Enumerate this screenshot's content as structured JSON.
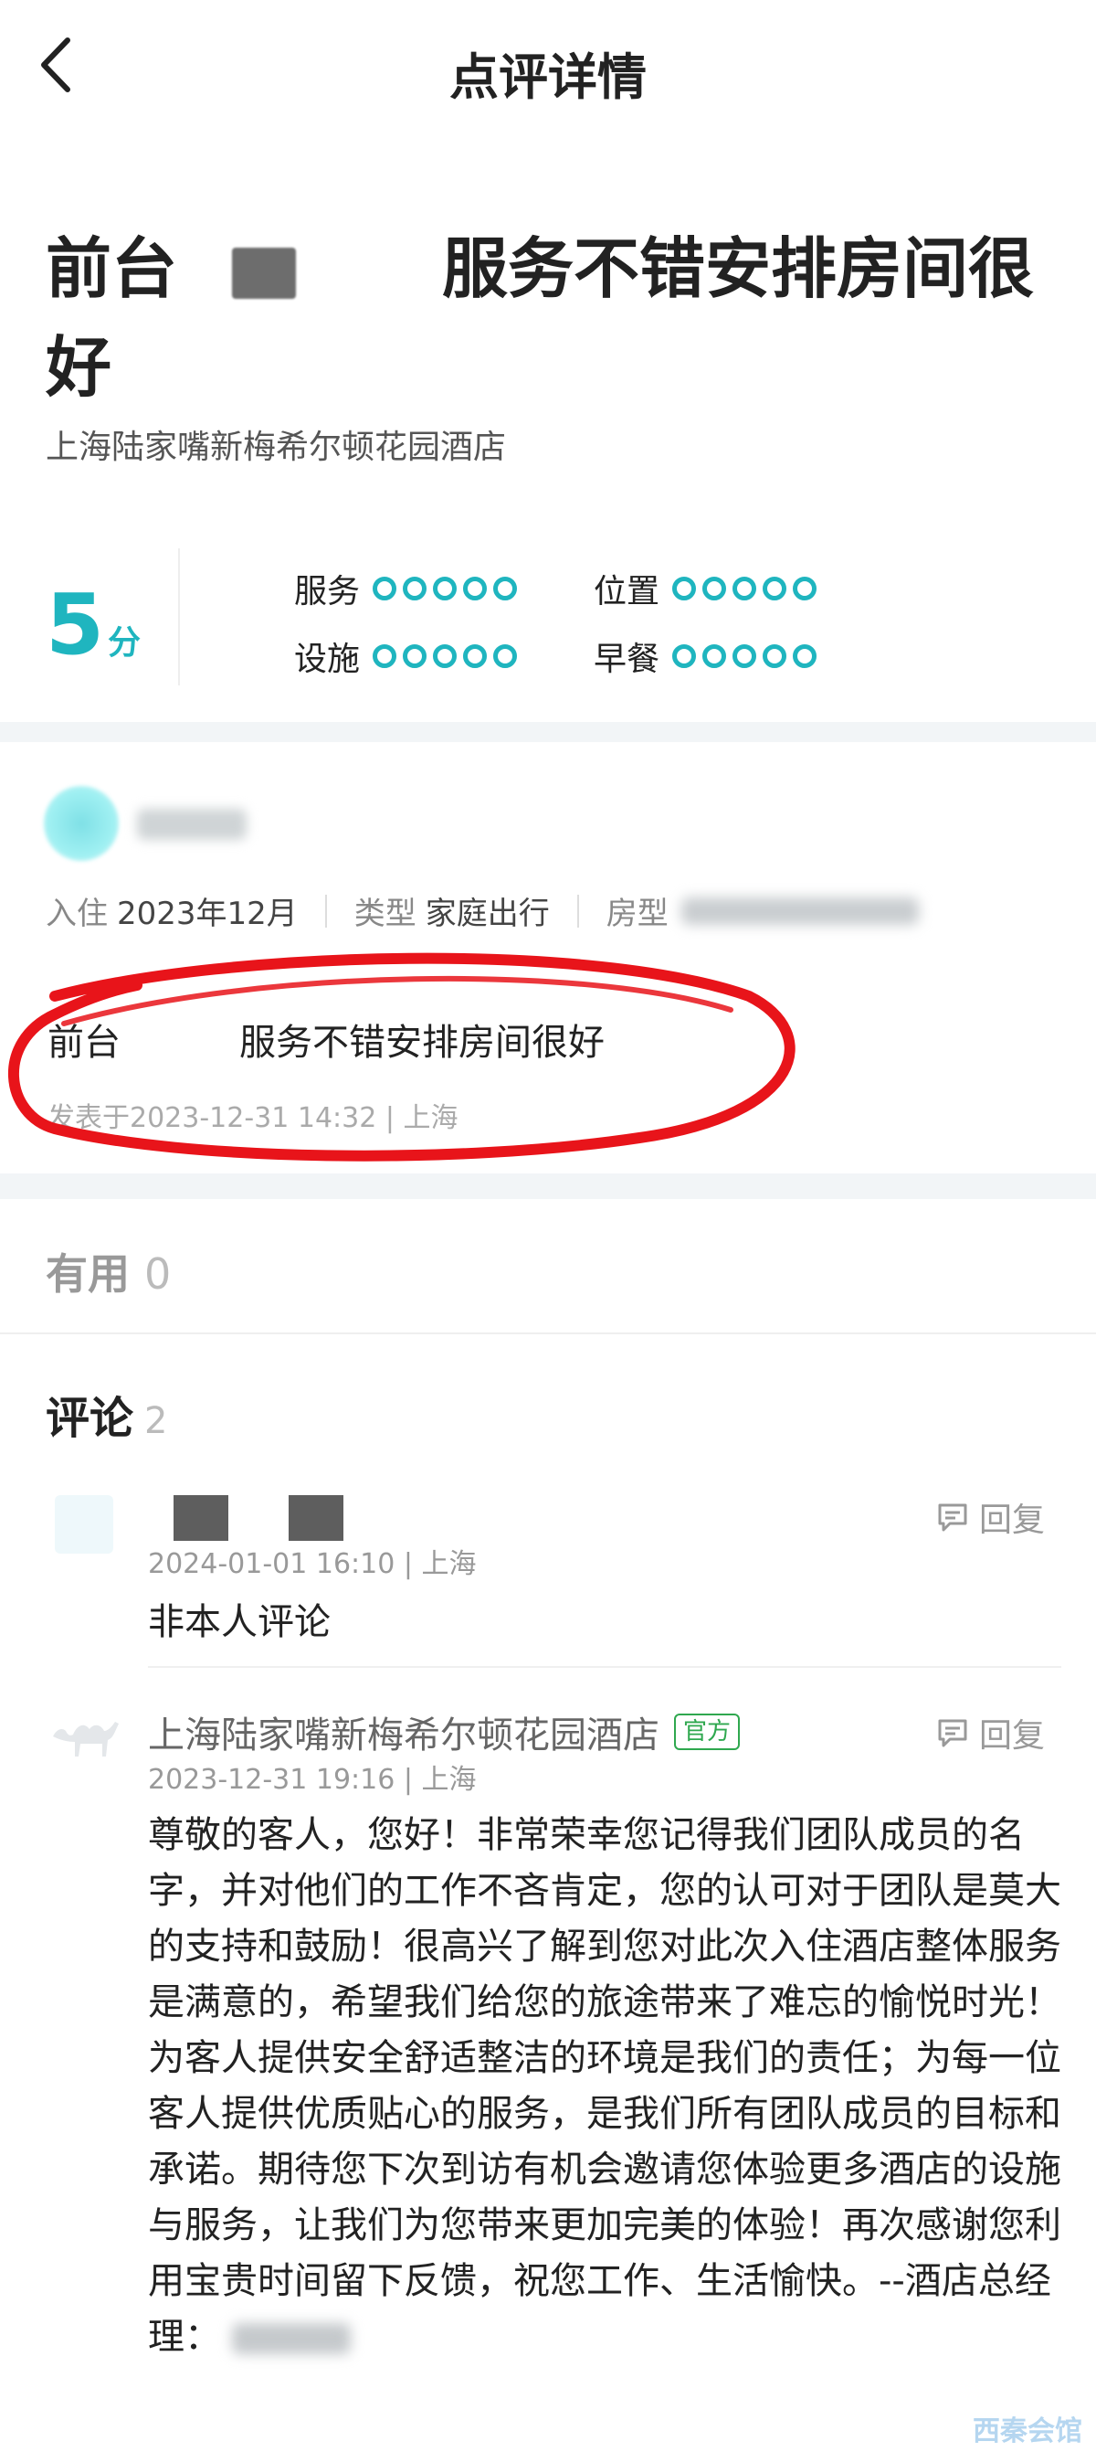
{
  "header": {
    "title": "点评详情"
  },
  "review": {
    "title_start": "前台",
    "title_end": "服务不错安排房间很好",
    "hotel_name": "上海陆家嘴新梅希尔顿花园酒店",
    "score": "5",
    "score_unit": "分",
    "ratings": [
      {
        "label": "服务",
        "value": 5
      },
      {
        "label": "位置",
        "value": 5
      },
      {
        "label": "设施",
        "value": 5
      },
      {
        "label": "早餐",
        "value": 5
      }
    ]
  },
  "user_review": {
    "checkin_label": "入住",
    "checkin_value": "2023年12月",
    "type_label": "类型",
    "type_value": "家庭出行",
    "room_label": "房型",
    "text_start": "前台",
    "text_end": "服务不错安排房间很好",
    "posted": "发表于2023-12-31 14:32 | 上海"
  },
  "useful": {
    "label": "有用",
    "count": "0"
  },
  "comments": {
    "label": "评论",
    "count": "2",
    "reply_label": "回复",
    "items": [
      {
        "time": "2024-01-01 16:10 | 上海",
        "text": "非本人评论"
      },
      {
        "author": "上海陆家嘴新梅希尔顿花园酒店",
        "badge": "官方",
        "time": "2023-12-31 19:16 | 上海",
        "text": "尊敬的客人，您好！非常荣幸您记得我们团队成员的名字，并对他们的工作不吝肯定，您的认可对于团队是莫大的支持和鼓励！很高兴了解到您对此次入住酒店整体服务是满意的，希望我们给您的旅途带来了难忘的愉悦时光！为客人提供安全舒适整洁的环境是我们的责任；为每一位客人提供优质贴心的服务，是我们所有团队成员的目标和承诺。期待您下次到访有机会邀请您体验更多酒店的设施与服务，让我们为您带来更加完美的体验！再次感谢您利用宝贵时间留下反馈，祝您工作、生活愉快。--酒店总经理："
      }
    ]
  },
  "watermark": "西秦会馆",
  "colors": {
    "accent": "#1fb5bf",
    "official": "#2fa84f",
    "annotation": "#e8141a"
  }
}
